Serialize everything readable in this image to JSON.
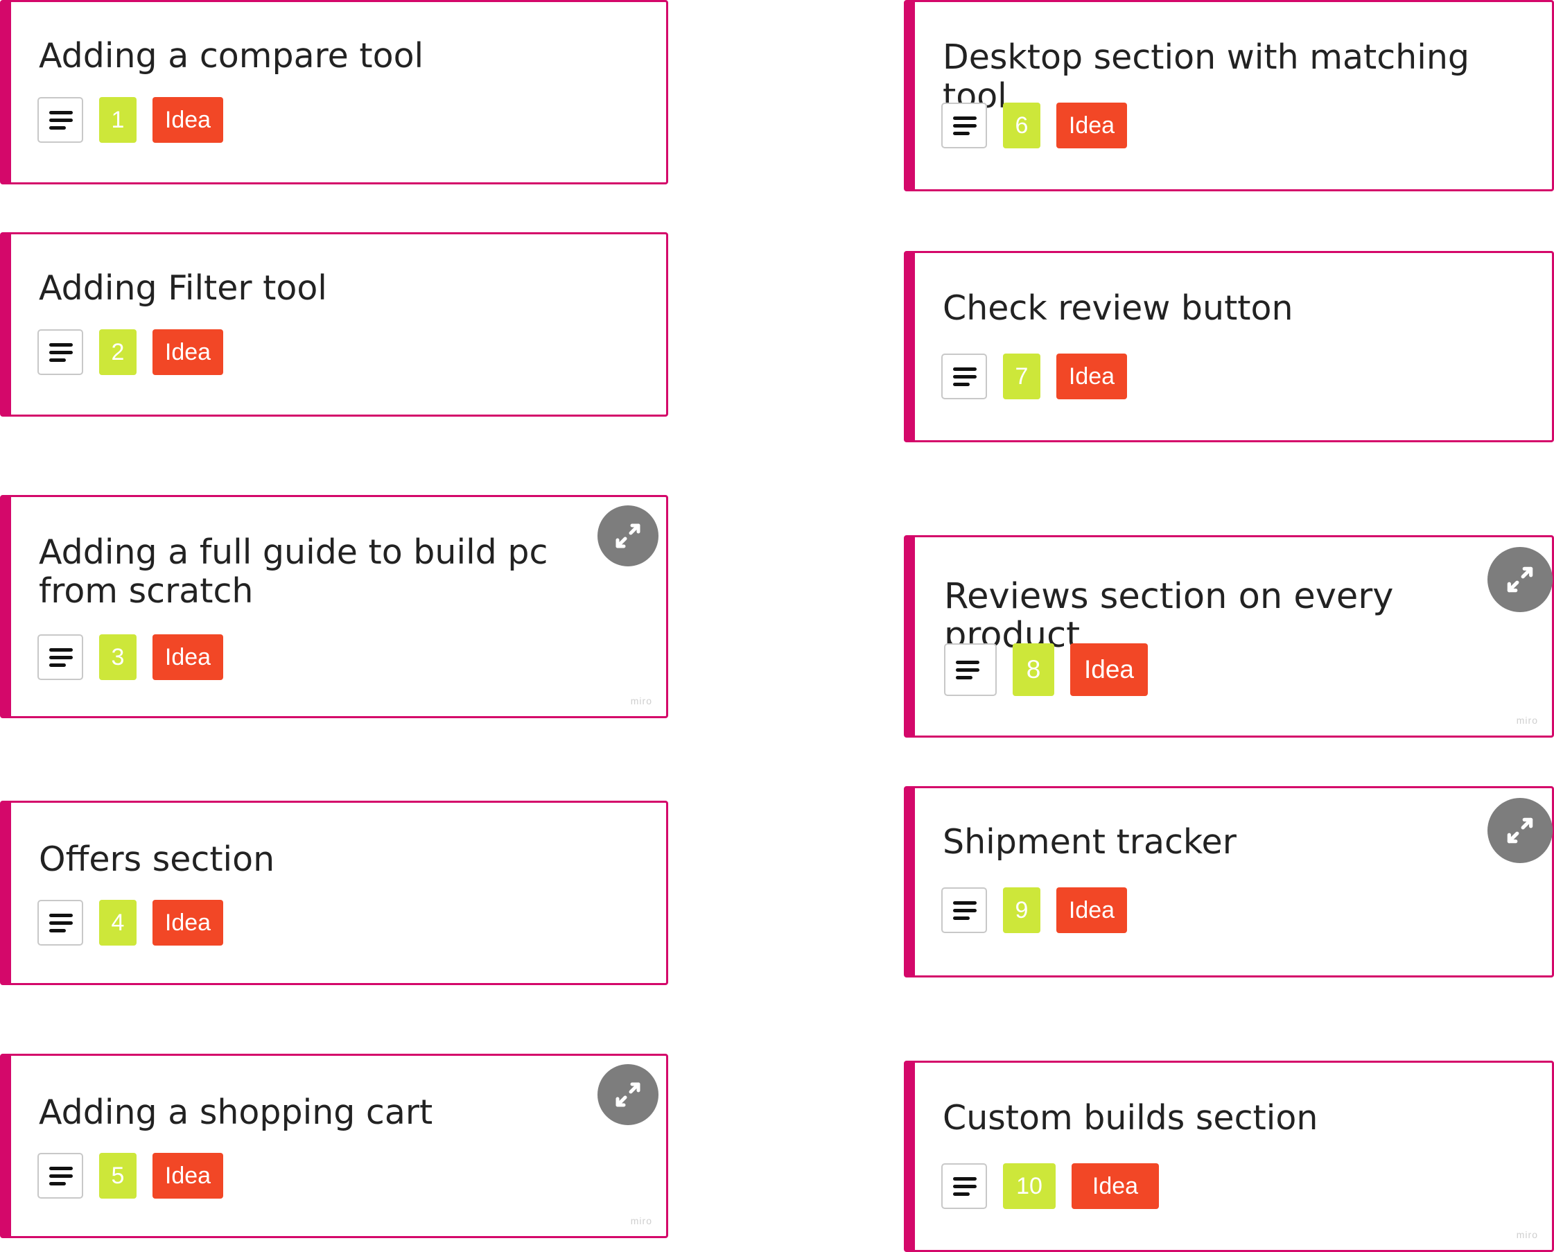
{
  "colors": {
    "card_accent": "#d4086a",
    "number_tag": "#cde73a",
    "idea_tag": "#f24726",
    "expand_button": "#7d7d7d"
  },
  "cards": [
    {
      "title": "Adding a compare tool",
      "number": "1",
      "tag": "Idea"
    },
    {
      "title": "Adding Filter tool",
      "number": "2",
      "tag": "Idea"
    },
    {
      "title": "Adding a full guide to build pc from scratch",
      "number": "3",
      "tag": "Idea",
      "watermark": "miro"
    },
    {
      "title": "Offers section",
      "number": "4",
      "tag": "Idea"
    },
    {
      "title": "Adding a shopping cart",
      "number": "5",
      "tag": "Idea",
      "watermark": "miro"
    },
    {
      "title": "Desktop section with matching tool",
      "number": "6",
      "tag": "Idea"
    },
    {
      "title": "Check review button",
      "number": "7",
      "tag": "Idea"
    },
    {
      "title": "Reviews section on every product",
      "number": "8",
      "tag": "Idea",
      "watermark": "miro"
    },
    {
      "title": "Shipment tracker",
      "number": "9",
      "tag": "Idea"
    },
    {
      "title": "Custom builds section",
      "number": "10",
      "tag": "Idea",
      "watermark": "miro"
    }
  ],
  "icons": {
    "description": "description-icon",
    "expand": "expand-icon"
  }
}
